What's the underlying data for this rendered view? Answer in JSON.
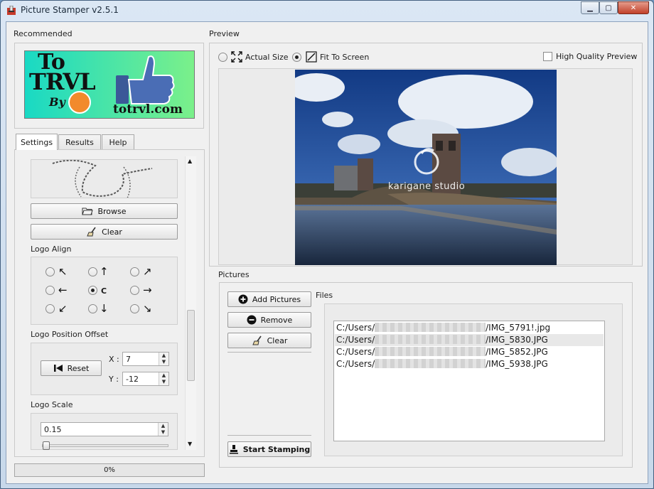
{
  "window": {
    "title": "Picture Stamper v2.5.1"
  },
  "left": {
    "recommended_label": "Recommended",
    "banner": {
      "text_to": "To",
      "text_trvl": "TRVL",
      "text_by": "By",
      "site": "totrvl.com"
    },
    "tabs": [
      {
        "label": "Settings"
      },
      {
        "label": "Results"
      },
      {
        "label": "Help"
      }
    ],
    "settings": {
      "browse_label": "Browse",
      "clear_label": "Clear",
      "logo_align_label": "Logo Align",
      "align_center_label": "C",
      "align_selected": "center",
      "offset_label": "Logo Position Offset",
      "reset_label": "Reset",
      "x_label": "X :",
      "x_value": "7",
      "y_label": "Y :",
      "y_value": "-12",
      "scale_label": "Logo Scale",
      "scale_value": "0.15",
      "scale_fraction": 0.15
    },
    "progress": {
      "text": "0%",
      "value": 0
    }
  },
  "preview": {
    "label": "Preview",
    "actual_size_label": "Actual Size",
    "fit_to_screen_label": "Fit To Screen",
    "selected_mode": "fit",
    "high_quality_label": "High Quality Preview",
    "high_quality_checked": false,
    "watermark_text": "karigane studio"
  },
  "pictures": {
    "label": "Pictures",
    "add_label": "Add Pictures",
    "remove_label": "Remove",
    "clear_label": "Clear",
    "start_label": "Start Stamping",
    "files_label": "Files",
    "files": [
      {
        "prefix": "C:/Users/",
        "name": "/IMG_5791!.jpg"
      },
      {
        "prefix": "C:/Users/",
        "name": "/IMG_5830.JPG"
      },
      {
        "prefix": "C:/Users/",
        "name": "/IMG_5852.JPG"
      },
      {
        "prefix": "C:/Users/",
        "name": "/IMG_5938.JPG"
      }
    ]
  },
  "colors": {
    "banner_cyan": "#19d9c4",
    "banner_green": "#7bf08a",
    "thumb_blue": "#3b5998",
    "select_row": "#e8e8e8"
  }
}
